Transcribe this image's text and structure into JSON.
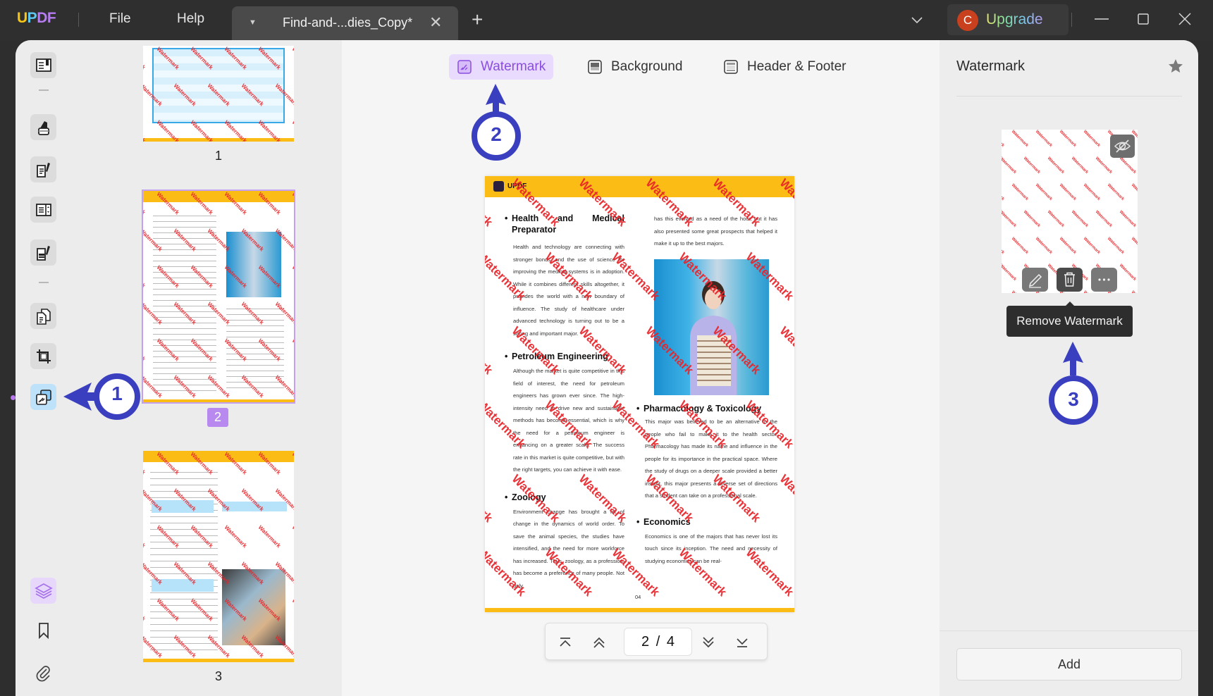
{
  "titlebar": {
    "logo": [
      "U",
      "P",
      "D",
      "F"
    ],
    "logo_colors": [
      "#f5c518",
      "#5ec8f0",
      "#b67cf0",
      "#b67cf0"
    ],
    "menu": {
      "file": "File",
      "help": "Help"
    },
    "tab": {
      "name": "Find-and-...dies_Copy*"
    },
    "upgrade": {
      "avatar_letter": "C",
      "label": "Upgrade"
    }
  },
  "rail": {
    "items": [
      {
        "name": "reader",
        "icon": "book-icon"
      },
      {
        "name": "comment",
        "icon": "highlighter-icon"
      },
      {
        "name": "edit-pdf",
        "icon": "edit-document-icon"
      },
      {
        "name": "form",
        "icon": "form-icon"
      },
      {
        "name": "fill-sign",
        "icon": "sign-document-icon"
      },
      {
        "name": "organize-pages",
        "icon": "pages-icon"
      },
      {
        "name": "crop",
        "icon": "crop-icon"
      },
      {
        "name": "page-tools",
        "icon": "watermark-tool-icon",
        "active": true
      },
      {
        "name": "layers",
        "icon": "layers-icon"
      },
      {
        "name": "bookmark",
        "icon": "bookmark-icon"
      },
      {
        "name": "attachment",
        "icon": "paperclip-icon"
      }
    ]
  },
  "thumbnails": [
    {
      "page": "1"
    },
    {
      "page": "2",
      "selected": true
    },
    {
      "page": "3"
    }
  ],
  "toolbar": {
    "tools": [
      {
        "label": "Watermark",
        "active": true
      },
      {
        "label": "Background"
      },
      {
        "label": "Header & Footer"
      }
    ]
  },
  "page": {
    "brand": "UPDF",
    "watermark_text": "Watermark",
    "watermark_color": "#e8242a",
    "left_column": [
      {
        "heading": "Health and Medical Preparator",
        "body": "Health and technology are connecting with stronger bonds, and the use of science for improving the medical systems is in adoption. While it combines different skills altogether, it provides the world with a new boundary of influence. The study of healthcare under advanced technology is turning out to be a strong and important major."
      },
      {
        "heading": "Petroleum Engineering",
        "body": "Although the market is quite competitive in this field of interest, the need for petroleum engineers has grown ever since. The high-intensity need to drive new and sustainable methods has become essential, which is why the need for a petroleum engineer is enhancing on a greater scale. The success rate in this market is quite competitive, but with the right targets, you can achieve it with ease."
      },
      {
        "heading": "Zoology",
        "body": "Environment change has brought a lot of change in the dynamics of world order. To save the animal species, the studies have intensified, and the need for more workforce has increased. Thus, zoology, as a profession, has become a preference of many people. Not only"
      }
    ],
    "right_intro": "has this evolved as a need of the hour, but it has also presented some great prospects that helped it make it up to the best majors.",
    "right_column": [
      {
        "heading": "Pharmacology & Toxicology",
        "body": "This major was believed to be an alternative to the people who fail to make it to the health sector. Pharmacology has made its name and influence in the people for its importance in the practical space. Where the study of drugs on a deeper scale provided a better insight, this major presents a diverse set of directions that a student can take on a professional scale."
      },
      {
        "heading": "Economics",
        "body": "Economics is one of the majors that has never lost its touch since its inception. The need and necessity of studying economics can be real-"
      }
    ],
    "page_number": "04"
  },
  "pager": {
    "current": "2",
    "total": "4",
    "display": "2 / 4"
  },
  "right_panel": {
    "title": "Watermark",
    "tooltip": "Remove Watermark",
    "add_label": "Add"
  },
  "annotations": [
    "1",
    "2",
    "3"
  ],
  "colors": {
    "accent_purple": "#8a4de0",
    "annotation_blue": "#3a3fc0",
    "page_yellow": "#fbbd15"
  }
}
